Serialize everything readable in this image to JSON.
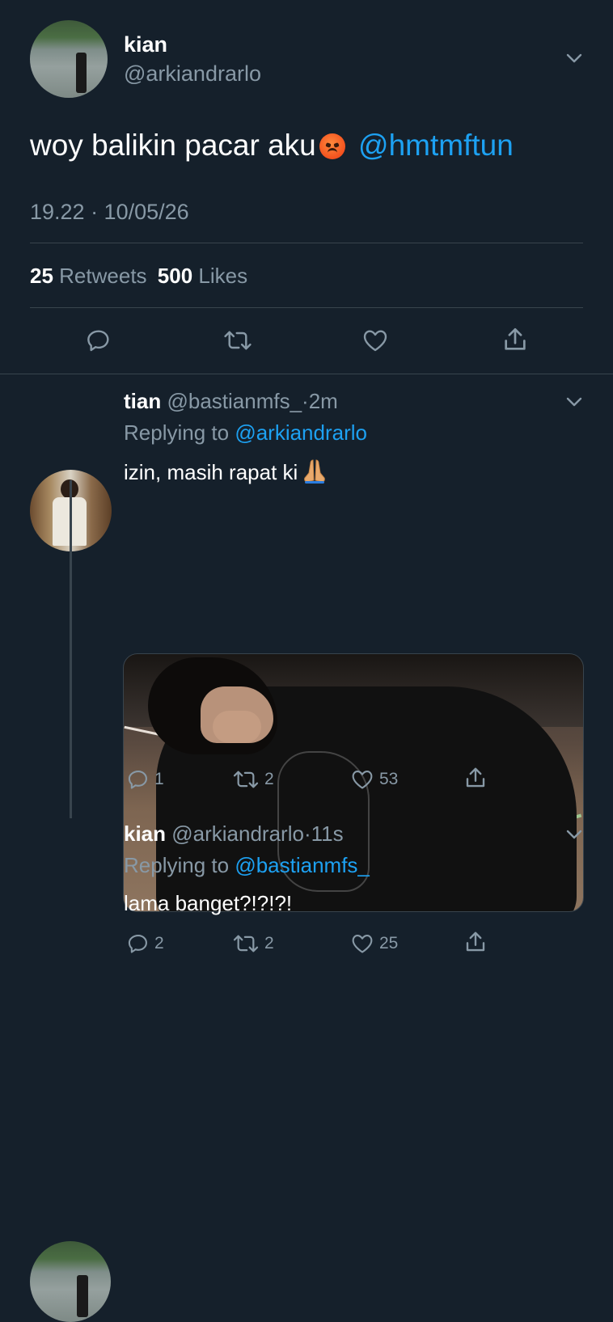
{
  "main_tweet": {
    "name": "kian",
    "handle": "@arkiandrarlo",
    "text": "woy balikin pacar aku",
    "emoji": "pouting-face",
    "mention": "@hmtmftun",
    "timestamp": "19.22 · 10/05/26",
    "retweets_count": "25",
    "retweets_label": "Retweets",
    "likes_count": "500",
    "likes_label": "Likes"
  },
  "reply_1": {
    "name": "tian",
    "handle": "@bastianmfs_",
    "sep": "·",
    "time": "2m",
    "replying_label": "Replying to",
    "replying_to": "@arkiandrarlo",
    "text": "izin, masih rapat ki",
    "emoji": "folded-hands",
    "replies": "1",
    "retweets": "2",
    "likes": "53"
  },
  "reply_2": {
    "name": "kian",
    "handle": "@arkiandrarlo",
    "sep": "·",
    "time": "11s",
    "replying_label": "Replying to",
    "replying_to": "@bastianmfs_",
    "text": "lama banget?!?!?!",
    "replies": "2",
    "retweets": "2",
    "likes": "25"
  },
  "colors": {
    "background": "#15202b",
    "link": "#1da1f2",
    "muted": "#8899a6",
    "divider": "#38444d"
  }
}
